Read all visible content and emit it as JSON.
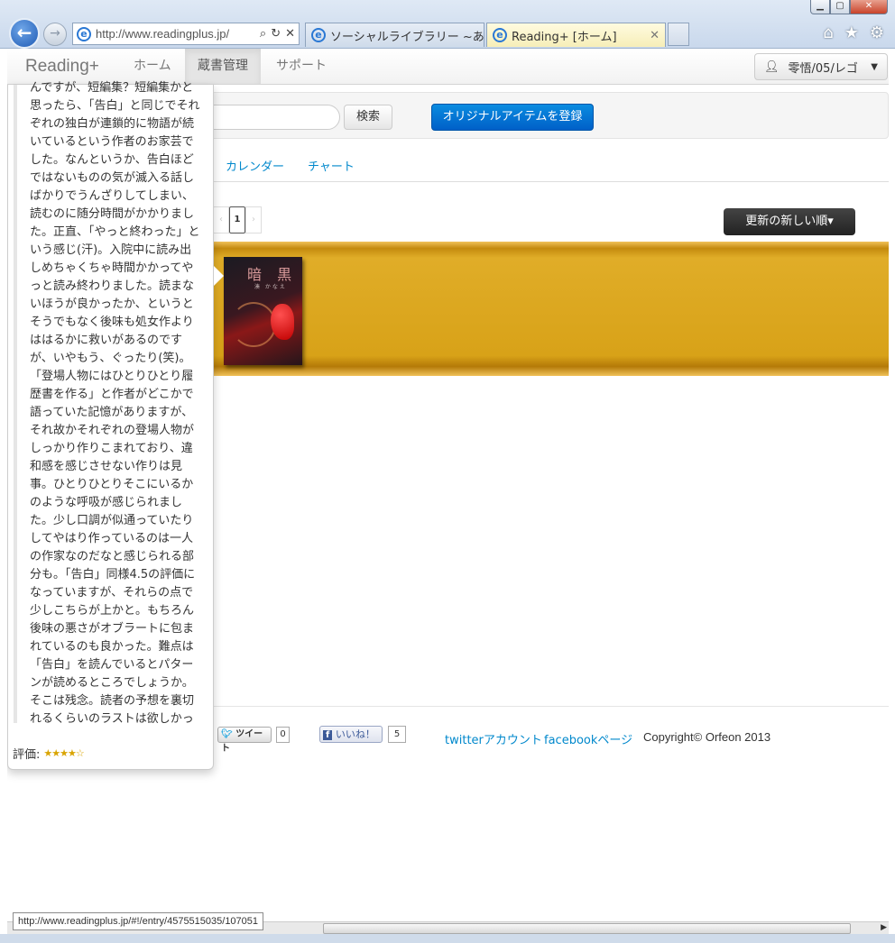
{
  "browser": {
    "address": {
      "url": "http://www.readingplus.jp/"
    },
    "tabs": [
      {
        "label": "ソーシャルライブラリー ~あ..."
      },
      {
        "label": "Reading+ [ホーム]"
      }
    ],
    "status_url": "http://www.readingplus.jp/#!/entry/4575515035/107051"
  },
  "navbar": {
    "brand": "Reading+",
    "items": [
      "ホーム",
      "蔵書管理",
      "サポート"
    ],
    "user": "零悟/05/レゴ"
  },
  "search": {
    "button_label": "検索",
    "register_label": "オリジナルアイテムを登録"
  },
  "subtabs": [
    "カレンダー",
    "チャート"
  ],
  "pagination": {
    "prev": "‹",
    "current": "1",
    "next": "›"
  },
  "sort": {
    "label": "更新の新しい順▾"
  },
  "book": {
    "title": "暗 黒",
    "author": "湊 かなえ"
  },
  "popover": {
    "text": "んですが、短編集？短編集かと思ったら、「告白」と同じでそれぞれの独白が連鎖的に物語が続いているという作者のお家芸でした。なんというか、告白ほどではないものの気が滅入る話しばかりでうんざりしてしまい、読むのに随分時間がかかりました。正直、「やっと終わった」という感じ(汗)。入院中に読み出しめちゃくちゃ時間かかってやっと読み終わりました。読まないほうが良かったか、というとそうでもなく後味も処女作よりははるかに救いがあるのですが、いやもう、ぐったり(笑)。「登場人物にはひとりひとり履歴書を作る」と作者がどこかで語っていた記憶がありますが、それ故かそれぞれの登場人物がしっかり作りこまれており、違和感を感じさせない作りは見事。ひとりひとりそこにいるかのような呼吸が感じられました。少し口調が似通っていたりしてやはり作っているのは一人の作家なのだなと感じられる部分も。「告白」同様4.5の評価になっていますが、それらの点で少しこちらが上かと。もちろん後味の悪さがオブラートに包まれているのも良かった。難点は「告白」を読んでいるとパターンが読めるところでしょうか。そこは残念。読者の予想を裏切れるくらいのラストは欲しかった。",
    "rating_label": "評価:",
    "rating_stars": "★★★★☆"
  },
  "footer": {
    "tweet_label": "ツイート",
    "tweet_count": "0",
    "like_label": "いいね！",
    "like_count": "5",
    "twitter_link": "twitterアカウント",
    "facebook_link": "facebookページ",
    "copyright": "Copyright© Orfeon 2013"
  }
}
